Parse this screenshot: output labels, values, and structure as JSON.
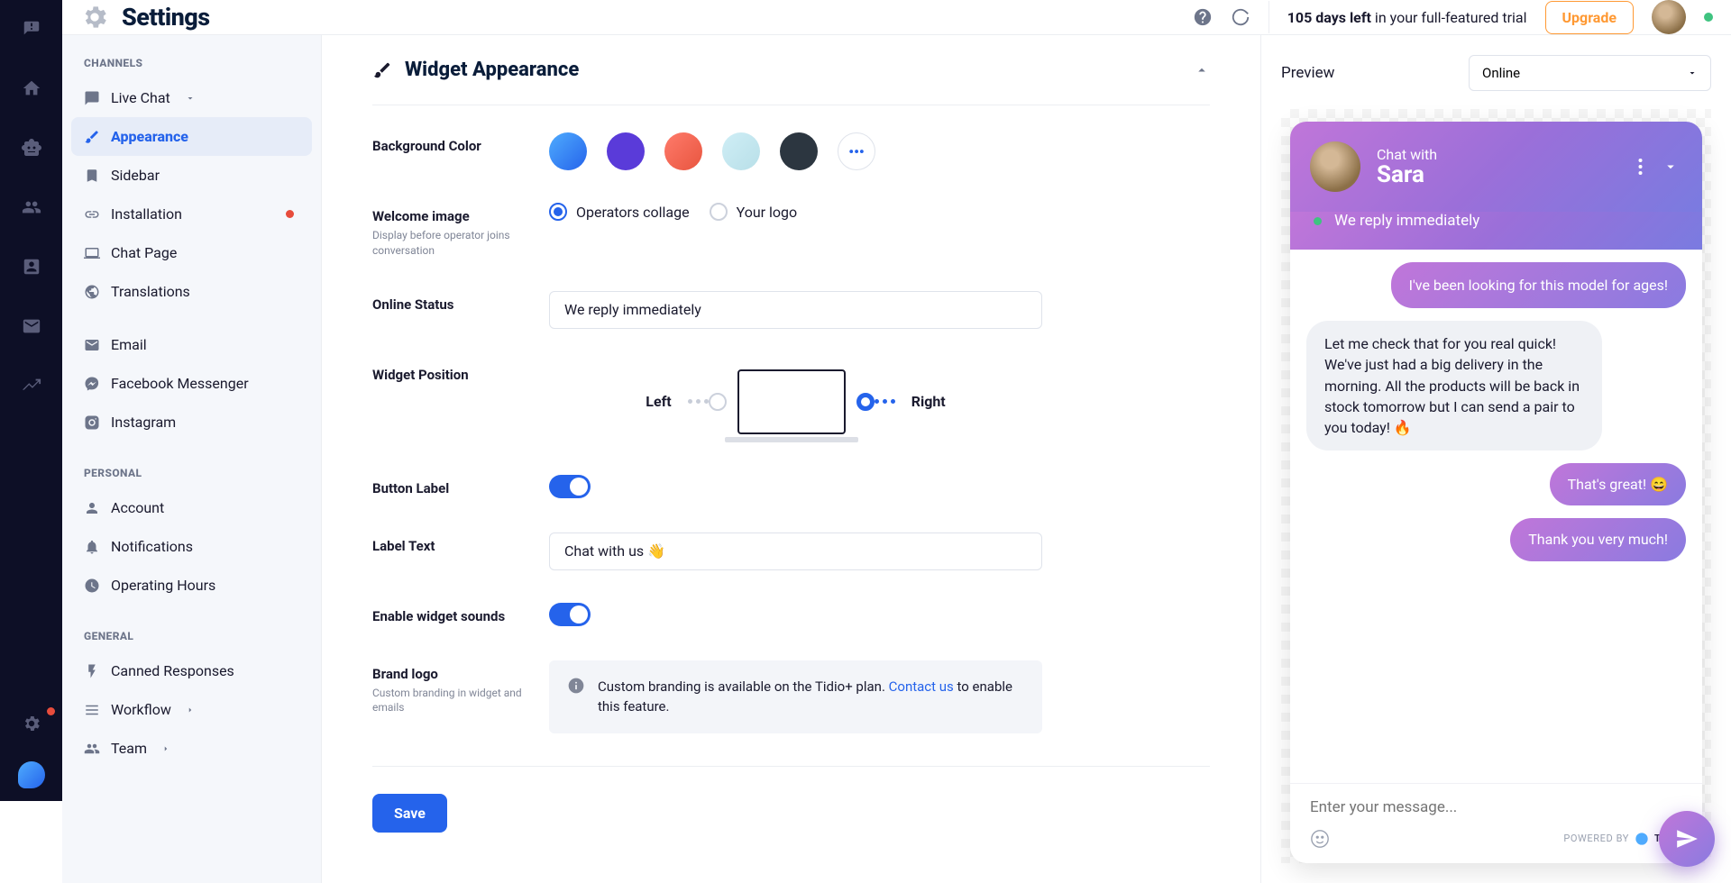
{
  "header": {
    "title": "Settings",
    "trial_bold": "105 days left",
    "trial_rest": " in your full-featured trial",
    "upgrade": "Upgrade"
  },
  "sidebar": {
    "group_channels": "CHANNELS",
    "group_personal": "PERSONAL",
    "group_general": "GENERAL",
    "live_chat": "Live Chat",
    "appearance": "Appearance",
    "sidebar_item": "Sidebar",
    "installation": "Installation",
    "chat_page": "Chat Page",
    "translations": "Translations",
    "email": "Email",
    "messenger": "Facebook Messenger",
    "instagram": "Instagram",
    "account": "Account",
    "notifications": "Notifications",
    "hours": "Operating Hours",
    "canned": "Canned Responses",
    "workflow": "Workflow",
    "team": "Team"
  },
  "main": {
    "title": "Widget Appearance",
    "bg_label": "Background Color",
    "welcome_label": "Welcome image",
    "welcome_sub": "Display before operator joins conversation",
    "radio1": "Operators collage",
    "radio2": "Your logo",
    "online_label": "Online Status",
    "online_value": "We reply immediately",
    "pos_label": "Widget Position",
    "pos_left": "Left",
    "pos_right": "Right",
    "btn_label": "Button Label",
    "label_text": "Label Text",
    "label_value": "Chat with us 👋",
    "sounds": "Enable widget sounds",
    "brand_label": "Brand logo",
    "brand_sub": "Custom branding in widget and emails",
    "brand_notice1": "Custom branding is available on the Tidio+ plan. ",
    "brand_link": "Contact us",
    "brand_notice2": " to enable this feature.",
    "save": "Save",
    "colors": {
      "c1": "linear-gradient(135deg,#4facfe,#2563eb)",
      "c2": "#5a3bd9",
      "c3": "linear-gradient(135deg,#ff7b6b,#e8553f)",
      "c4": "linear-gradient(135deg,#cfeef6,#b8dfe8)",
      "c5": "#2c3640"
    }
  },
  "preview": {
    "label": "Preview",
    "selected": "Online",
    "chat_with": "Chat with",
    "name": "Sara",
    "status": "We reply immediately",
    "m1": "I've been looking for this model for ages!",
    "m2": "Let me check that for you real quick! We've just had a big delivery in the morning. All the products will be back in stock tomorrow but I can send a pair to you today! 🔥",
    "m3": "That's great! 😄",
    "m4": "Thank you very much!",
    "placeholder": "Enter your message...",
    "powered": "POWERED BY",
    "brand": "TIDIO"
  }
}
